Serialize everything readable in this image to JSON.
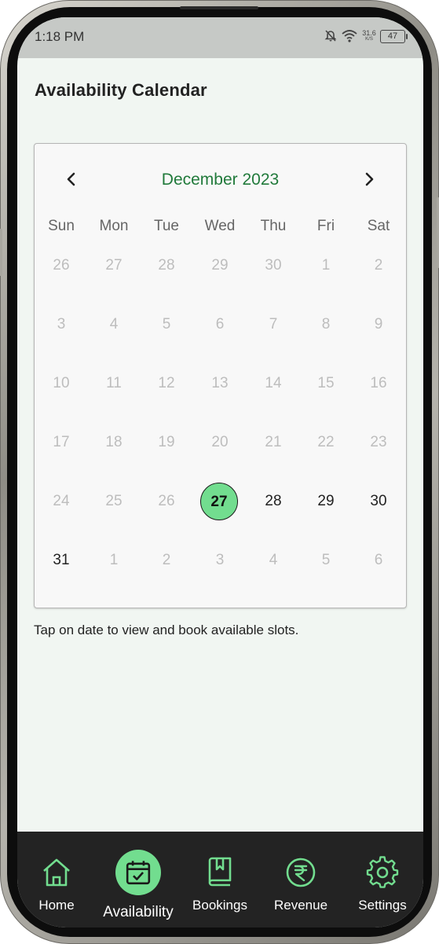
{
  "status_bar": {
    "time": "1:18 PM",
    "net_speed_value": "31.6",
    "net_speed_unit": "K/S",
    "battery": "47"
  },
  "page": {
    "title": "Availability Calendar",
    "hint": "Tap on date to view and book available slots."
  },
  "calendar": {
    "month_label": "December 2023",
    "weekdays": [
      "Sun",
      "Mon",
      "Tue",
      "Wed",
      "Thu",
      "Fri",
      "Sat"
    ],
    "weeks": [
      [
        {
          "d": "26",
          "s": "disabled"
        },
        {
          "d": "27",
          "s": "disabled"
        },
        {
          "d": "28",
          "s": "disabled"
        },
        {
          "d": "29",
          "s": "disabled"
        },
        {
          "d": "30",
          "s": "disabled"
        },
        {
          "d": "1",
          "s": "disabled"
        },
        {
          "d": "2",
          "s": "disabled"
        }
      ],
      [
        {
          "d": "3",
          "s": "disabled"
        },
        {
          "d": "4",
          "s": "disabled"
        },
        {
          "d": "5",
          "s": "disabled"
        },
        {
          "d": "6",
          "s": "disabled"
        },
        {
          "d": "7",
          "s": "disabled"
        },
        {
          "d": "8",
          "s": "disabled"
        },
        {
          "d": "9",
          "s": "disabled"
        }
      ],
      [
        {
          "d": "10",
          "s": "disabled"
        },
        {
          "d": "11",
          "s": "disabled"
        },
        {
          "d": "12",
          "s": "disabled"
        },
        {
          "d": "13",
          "s": "disabled"
        },
        {
          "d": "14",
          "s": "disabled"
        },
        {
          "d": "15",
          "s": "disabled"
        },
        {
          "d": "16",
          "s": "disabled"
        }
      ],
      [
        {
          "d": "17",
          "s": "disabled"
        },
        {
          "d": "18",
          "s": "disabled"
        },
        {
          "d": "19",
          "s": "disabled"
        },
        {
          "d": "20",
          "s": "disabled"
        },
        {
          "d": "21",
          "s": "disabled"
        },
        {
          "d": "22",
          "s": "disabled"
        },
        {
          "d": "23",
          "s": "disabled"
        }
      ],
      [
        {
          "d": "24",
          "s": "disabled"
        },
        {
          "d": "25",
          "s": "disabled"
        },
        {
          "d": "26",
          "s": "disabled"
        },
        {
          "d": "27",
          "s": "selected"
        },
        {
          "d": "28",
          "s": "current"
        },
        {
          "d": "29",
          "s": "current"
        },
        {
          "d": "30",
          "s": "current"
        }
      ],
      [
        {
          "d": "31",
          "s": "current"
        },
        {
          "d": "1",
          "s": "disabled"
        },
        {
          "d": "2",
          "s": "disabled"
        },
        {
          "d": "3",
          "s": "disabled"
        },
        {
          "d": "4",
          "s": "disabled"
        },
        {
          "d": "5",
          "s": "disabled"
        },
        {
          "d": "6",
          "s": "disabled"
        }
      ]
    ]
  },
  "bottom_nav": {
    "items": [
      {
        "label": "Home",
        "icon": "home-icon",
        "active": false
      },
      {
        "label": "Availability",
        "icon": "calendar-check-icon",
        "active": true
      },
      {
        "label": "Bookings",
        "icon": "bookmark-book-icon",
        "active": false
      },
      {
        "label": "Revenue",
        "icon": "rupee-icon",
        "active": false
      },
      {
        "label": "Settings",
        "icon": "gear-icon",
        "active": false
      }
    ]
  },
  "colors": {
    "accent_green": "#72dd8f",
    "month_text_green": "#217a3b",
    "nav_background": "#232323",
    "screen_background": "#f1f6f2"
  }
}
